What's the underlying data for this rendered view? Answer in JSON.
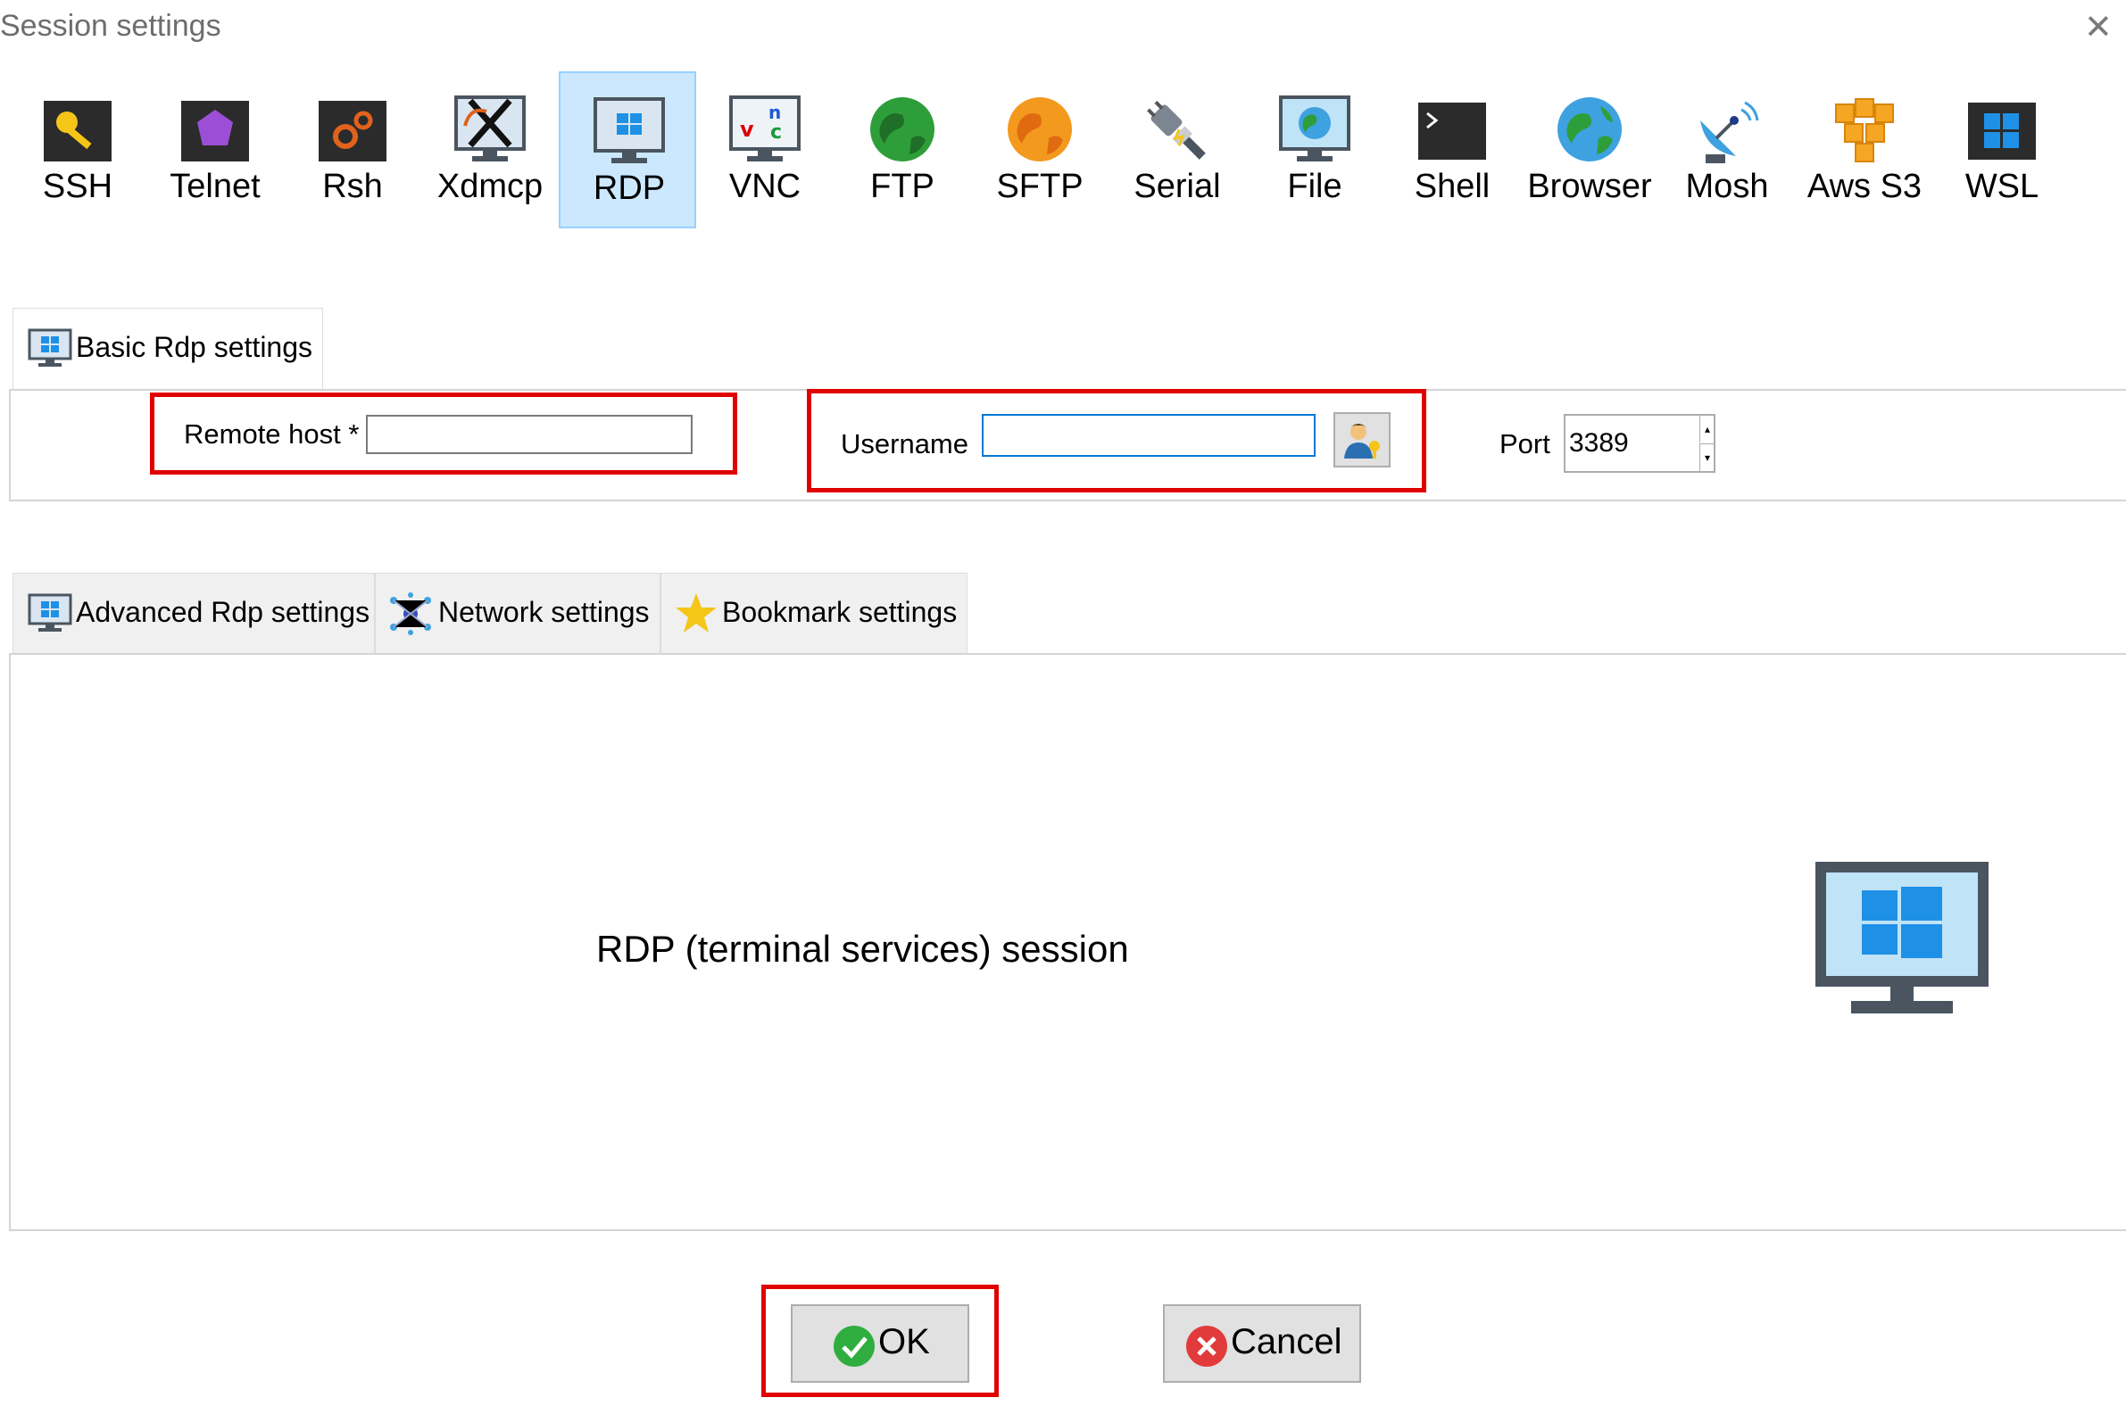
{
  "window": {
    "title": "Session settings"
  },
  "session_types": [
    {
      "label": "SSH",
      "icon": "ssh-key-icon"
    },
    {
      "label": "Telnet",
      "icon": "telnet-gem-icon"
    },
    {
      "label": "Rsh",
      "icon": "rsh-gears-icon"
    },
    {
      "label": "Xdmcp",
      "icon": "xdmcp-x-icon"
    },
    {
      "label": "RDP",
      "icon": "rdp-monitor-icon",
      "selected": true
    },
    {
      "label": "VNC",
      "icon": "vnc-monitor-icon"
    },
    {
      "label": "FTP",
      "icon": "ftp-globe-icon"
    },
    {
      "label": "SFTP",
      "icon": "sftp-globe-icon"
    },
    {
      "label": "Serial",
      "icon": "serial-plug-icon"
    },
    {
      "label": "File",
      "icon": "file-monitor-icon"
    },
    {
      "label": "Shell",
      "icon": "shell-terminal-icon"
    },
    {
      "label": "Browser",
      "icon": "browser-globe-icon"
    },
    {
      "label": "Mosh",
      "icon": "mosh-satellite-icon"
    },
    {
      "label": "Aws S3",
      "icon": "aws-s3-cubes-icon"
    },
    {
      "label": "WSL",
      "icon": "wsl-windows-icon"
    }
  ],
  "basic_tab": {
    "label": "Basic Rdp settings"
  },
  "basic": {
    "remote_host_label": "Remote host *",
    "remote_host_value": "",
    "username_label": "Username",
    "username_value": "",
    "port_label": "Port",
    "port_value": "3389"
  },
  "advanced_tabs": [
    {
      "label": "Advanced Rdp settings",
      "icon": "monitor-icon"
    },
    {
      "label": "Network settings",
      "icon": "network-icon"
    },
    {
      "label": "Bookmark settings",
      "icon": "star-icon"
    }
  ],
  "content": {
    "description": "RDP (terminal services) session"
  },
  "buttons": {
    "ok": "OK",
    "cancel": "Cancel"
  },
  "colors": {
    "highlight_red": "#e00000",
    "selection_blue": "#cce8ff",
    "windows_blue": "#1e90e6"
  }
}
